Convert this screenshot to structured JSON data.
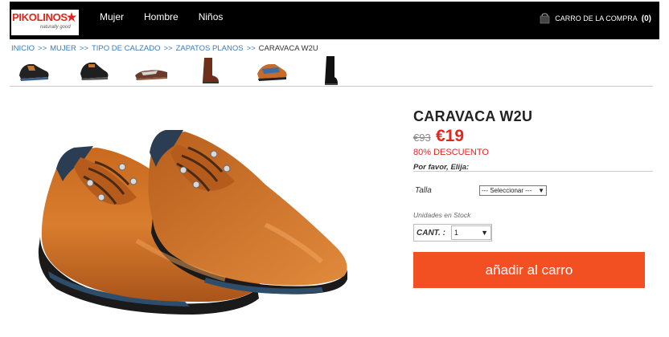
{
  "brand": {
    "name": "PIKOLINOS",
    "tagline": "naturally good"
  },
  "nav": {
    "items": [
      "Mujer",
      "Hombre",
      "Niños"
    ]
  },
  "cart": {
    "label": "CARRO DE LA COMPRA",
    "count": "(0)"
  },
  "breadcrumb": {
    "items": [
      "INICIO",
      "MUJER",
      "TIPO DE CALZADO",
      "ZAPATOS PLANOS"
    ],
    "separator": ">>",
    "current": "CARAVACA W2U"
  },
  "product": {
    "title": "CARAVACA W2U",
    "old_price": "€93",
    "new_price": "€19",
    "discount": "80% DESCUENTO",
    "greeting": "Por favor, Elija:",
    "size_label": "Talla",
    "size_select": "--- Seleccionar ---",
    "stock_label": "Unidades en Stock",
    "qty_label": "CANT. :",
    "qty_value": "1",
    "add_button": "añadir al carro"
  },
  "colors": {
    "accent": "#f25022",
    "price_red": "#e1261c",
    "topbar": "#000000",
    "link": "#3a7cb8"
  }
}
